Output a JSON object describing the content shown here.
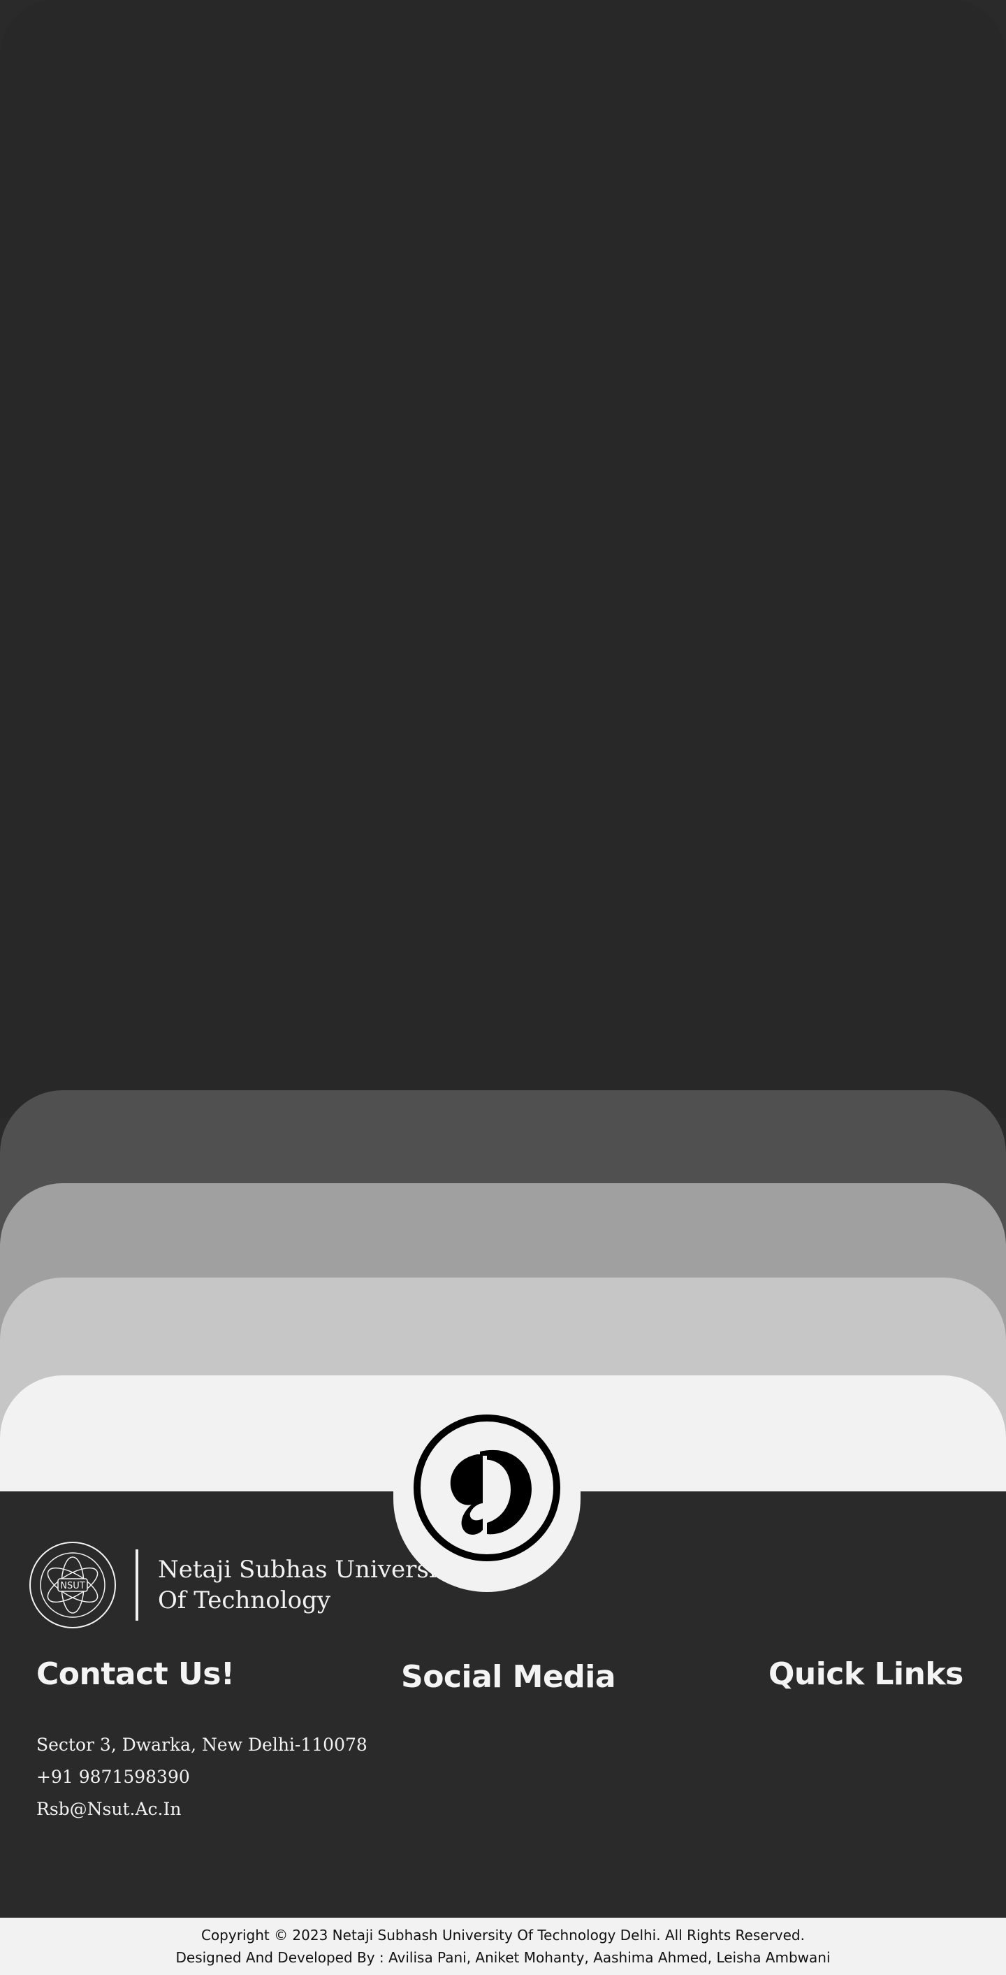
{
  "brand": {
    "university_line1": "Netaji Subhas University",
    "university_line2": "Of Technology",
    "seal_text": "NSUT",
    "logo_icon": "rsb-monogram-logo-icon"
  },
  "contact": {
    "heading": "Contact Us!",
    "address": "Sector 3, Dwarka, New Delhi-110078",
    "phone": "+91 9871598390",
    "email": "Rsb@Nsut.Ac.In"
  },
  "social": {
    "heading": "Social Media"
  },
  "quick_links": {
    "heading": "Quick Links"
  },
  "footer": {
    "copyright": "Copyright © 2023 Netaji Subhash University Of Technology Delhi. All Rights Reserved.",
    "credits": "Designed And Developed By : Avilisa Pani, Aniket Mohanty, Aashima Ahmed, Leisha Ambwani"
  },
  "colors": {
    "hero": "#282828",
    "layer1": "#505050",
    "layer2": "#a0a0a0",
    "layer3": "#c6c6c6",
    "layer4": "#f2f2f2",
    "footer": "#2a2a2a"
  }
}
